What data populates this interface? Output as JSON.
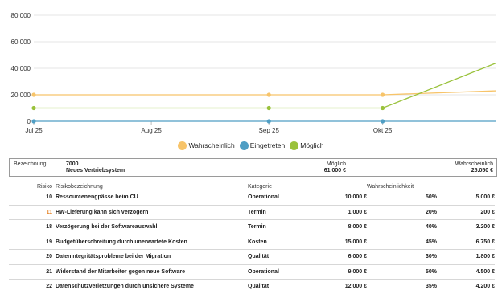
{
  "chart_data": {
    "type": "line",
    "x_ticks": [
      "Jul 25",
      "Aug 25",
      "Sep 25",
      "Okt 25"
    ],
    "y_ticks": [
      "0",
      "20,000",
      "40,000",
      "60,000",
      "80,000"
    ],
    "ylim": [
      0,
      80000
    ],
    "grid": true,
    "legend_position": "bottom-center",
    "series": [
      {
        "name": "Wahrscheinlich",
        "color": "#f7c46a",
        "points": [
          [
            "2025-07-01",
            20000
          ],
          [
            "2025-09-01",
            20000
          ],
          [
            "2025-10-01",
            20000
          ],
          [
            "2025-10-31",
            23000
          ]
        ]
      },
      {
        "name": "Eingetreten",
        "color": "#4f9ec4",
        "points": [
          [
            "2025-07-01",
            0
          ],
          [
            "2025-09-01",
            0
          ],
          [
            "2025-10-01",
            0
          ],
          [
            "2025-10-31",
            0
          ]
        ]
      },
      {
        "name": "Möglich",
        "color": "#9ac23c",
        "points": [
          [
            "2025-07-01",
            10000
          ],
          [
            "2025-09-01",
            10000
          ],
          [
            "2025-10-01",
            10000
          ],
          [
            "2025-10-31",
            44000
          ]
        ]
      }
    ]
  },
  "legend": [
    {
      "label": "Wahrscheinlich",
      "color": "#f7c46a"
    },
    {
      "label": "Eingetreten",
      "color": "#4f9ec4"
    },
    {
      "label": "Möglich",
      "color": "#9ac23c"
    }
  ],
  "summary": {
    "label": "Bezeichnung",
    "project_id": "7000",
    "project_name": "Neues Vertriebsystem",
    "possible_label": "Möglich",
    "possible_value": "61.000 €",
    "likely_label": "Wahrscheinlich",
    "likely_value": "25.050 €"
  },
  "table": {
    "headers": {
      "risk": "Risiko",
      "name": "Risikobezeichnung",
      "category": "Kategorie",
      "cost": "",
      "probability": "Wahrscheinlichkeit",
      "expected": ""
    },
    "rows": [
      {
        "id": "10",
        "name": "Ressourcenengpässe beim CU",
        "category": "Operational",
        "cost": "10.000 €",
        "probability": "50%",
        "expected": "5.000 €",
        "highlight": false
      },
      {
        "id": "11",
        "name": "HW-Lieferung kann sich verzögern",
        "category": "Termin",
        "cost": "1.000 €",
        "probability": "20%",
        "expected": "200 €",
        "highlight": true
      },
      {
        "id": "18",
        "name": "Verzögerung bei der Softwareauswahl",
        "category": "Termin",
        "cost": "8.000 €",
        "probability": "40%",
        "expected": "3.200 €",
        "highlight": false
      },
      {
        "id": "19",
        "name": "Budgetüberschreitung durch unerwartete Kosten",
        "category": "Kosten",
        "cost": "15.000 €",
        "probability": "45%",
        "expected": "6.750 €",
        "highlight": false
      },
      {
        "id": "20",
        "name": "Datenintegritätsprobleme bei der Migration",
        "category": "Qualität",
        "cost": "6.000 €",
        "probability": "30%",
        "expected": "1.800 €",
        "highlight": false
      },
      {
        "id": "21",
        "name": "Widerstand der Mitarbeiter gegen neue Software",
        "category": "Operational",
        "cost": "9.000 €",
        "probability": "50%",
        "expected": "4.500 €",
        "highlight": false
      },
      {
        "id": "22",
        "name": "Datenschutzverletzungen durch unsichere Systeme",
        "category": "Qualität",
        "cost": "12.000 €",
        "probability": "35%",
        "expected": "4.200 €",
        "highlight": false
      }
    ]
  }
}
